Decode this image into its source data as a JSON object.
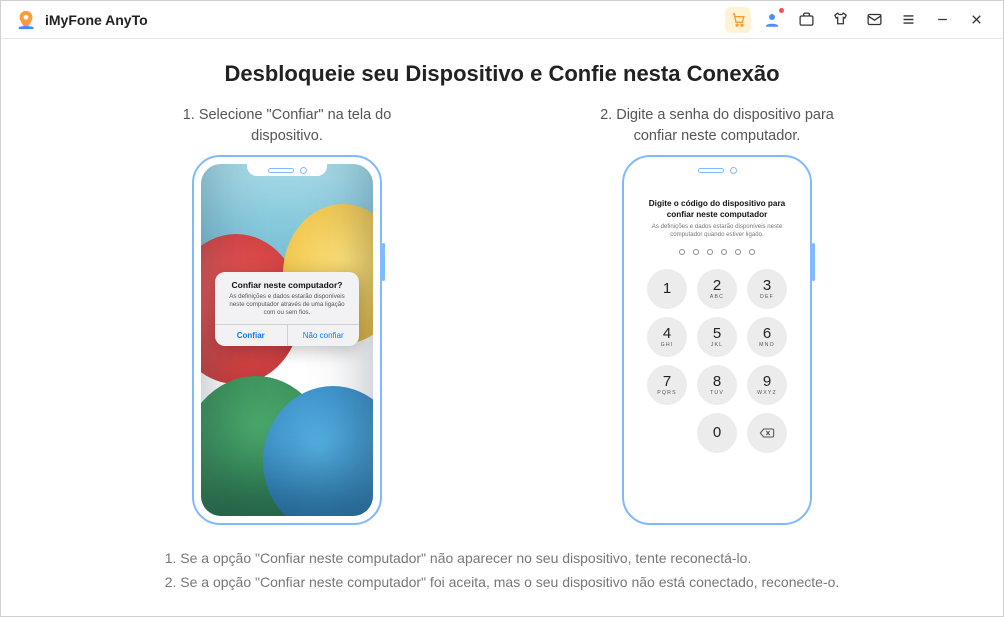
{
  "app": {
    "title": "iMyFone AnyTo"
  },
  "main": {
    "heading": "Desbloqueie seu Dispositivo e Confie nesta Conexão",
    "step1": "1. Selecione \"Confiar\" na tela do dispositivo.",
    "step2": "2. Digite a senha do dispositivo para confiar neste computador."
  },
  "alert": {
    "title": "Confiar neste computador?",
    "message": "As definições e dados estarão disponíveis neste computador através de uma ligação com ou sem fios.",
    "confirm": "Confiar",
    "deny": "Não confiar"
  },
  "passcode": {
    "title": "Digite o código do dispositivo para confiar neste computador",
    "subtitle": "As definições e dados estarão disponíveis neste computador quando estiver ligado."
  },
  "keypad": {
    "k1n": "1",
    "k1l": "",
    "k2n": "2",
    "k2l": "ABC",
    "k3n": "3",
    "k3l": "DEF",
    "k4n": "4",
    "k4l": "GHI",
    "k5n": "5",
    "k5l": "JKL",
    "k6n": "6",
    "k6l": "MNO",
    "k7n": "7",
    "k7l": "PQRS",
    "k8n": "8",
    "k8l": "TUV",
    "k9n": "9",
    "k9l": "WXYZ",
    "k0n": "0",
    "k0l": ""
  },
  "notes": {
    "n1": "1. Se a opção \"Confiar neste computador\" não aparecer no seu dispositivo, tente reconectá-lo.",
    "n2": "2. Se a opção \"Confiar neste computador\" foi aceita, mas o seu dispositivo não está conectado, reconecte-o."
  }
}
